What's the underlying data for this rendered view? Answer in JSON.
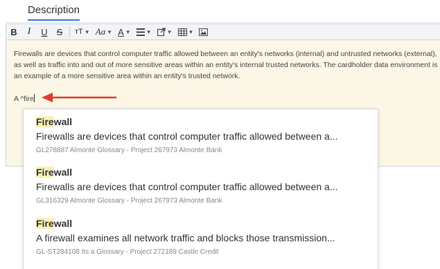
{
  "tab": {
    "label": "Description",
    "accent": "#3a7bd5"
  },
  "toolbar": {
    "bold": "B",
    "italic": "I",
    "underline": "U",
    "strikethrough": "S",
    "font_size": "тT",
    "font_family": "Aa",
    "font_color": "A",
    "icons": [
      "paragraph-align-icon",
      "link-icon",
      "table-icon",
      "image-icon"
    ]
  },
  "editor": {
    "background": "#fbf6e6",
    "paragraph": "Firewalls are devices that control computer traffic allowed between an entity's networks (internal) and untrusted networks (external), as well as traffic into and out of more sensitive areas within an entity's internal trusted networks. The cardholder data environment is an example of a more sensitive area within an entity's trusted network.",
    "typed_text": "A ^fire"
  },
  "annotation": {
    "arrow_color": "#e03a2b"
  },
  "suggestions": [
    {
      "match": "Fire",
      "rest": "wall",
      "definition": "Firewalls are devices that control computer traffic allowed between a...",
      "source": "GL278887 Almonte Glossary - Project 267973 Almonte Bank"
    },
    {
      "match": "Fire",
      "rest": "wall",
      "definition": "Firewalls are devices that control computer traffic allowed between a...",
      "source": "GL316329 Almonte Glossary - Project 267973 Almonte Bank"
    },
    {
      "match": "Fire",
      "rest": "wall",
      "definition": "A firewall examines all network traffic and blocks those transmission...",
      "source": "GL-ST284108 Its a Glossary - Project 272189 Castle Credit"
    }
  ]
}
